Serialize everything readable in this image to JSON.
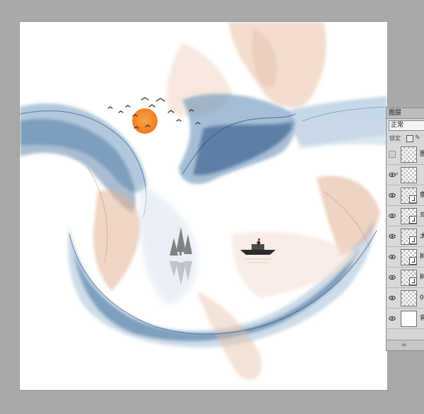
{
  "layers_panel": {
    "tab_title": "图层",
    "blend_mode": "正常",
    "lock_label": "锁定",
    "layers": [
      {
        "name": "图",
        "visible": false,
        "thumb": "checker",
        "clipped": false,
        "selected": false
      },
      {
        "name": "",
        "visible": true,
        "thumb": "checker",
        "clipped": false,
        "linked": true,
        "selected": false
      },
      {
        "name": "鱼",
        "visible": true,
        "thumb": "checker",
        "clipped": true,
        "selected": false
      },
      {
        "name": "鸟",
        "visible": true,
        "thumb": "checker",
        "clipped": true,
        "selected": false
      },
      {
        "name": "太",
        "visible": true,
        "thumb": "checker",
        "clipped": true,
        "selected": false
      },
      {
        "name": "树",
        "visible": true,
        "thumb": "checker",
        "clipped": true,
        "selected": false
      },
      {
        "name": "树",
        "visible": true,
        "thumb": "checker",
        "clipped": true,
        "selected": false
      },
      {
        "name": "0",
        "visible": true,
        "thumb": "checker",
        "clipped": false,
        "selected": false
      },
      {
        "name": "背",
        "visible": true,
        "thumb": "white",
        "clipped": false,
        "selected": false
      }
    ],
    "footer_icon": "link-icon"
  },
  "colors": {
    "workspace": "#a9a9a9",
    "canvas": "#ffffff",
    "ink_blue": "#2f5f8f",
    "ink_peach": "#d9a080",
    "sun": "#f08a30"
  }
}
